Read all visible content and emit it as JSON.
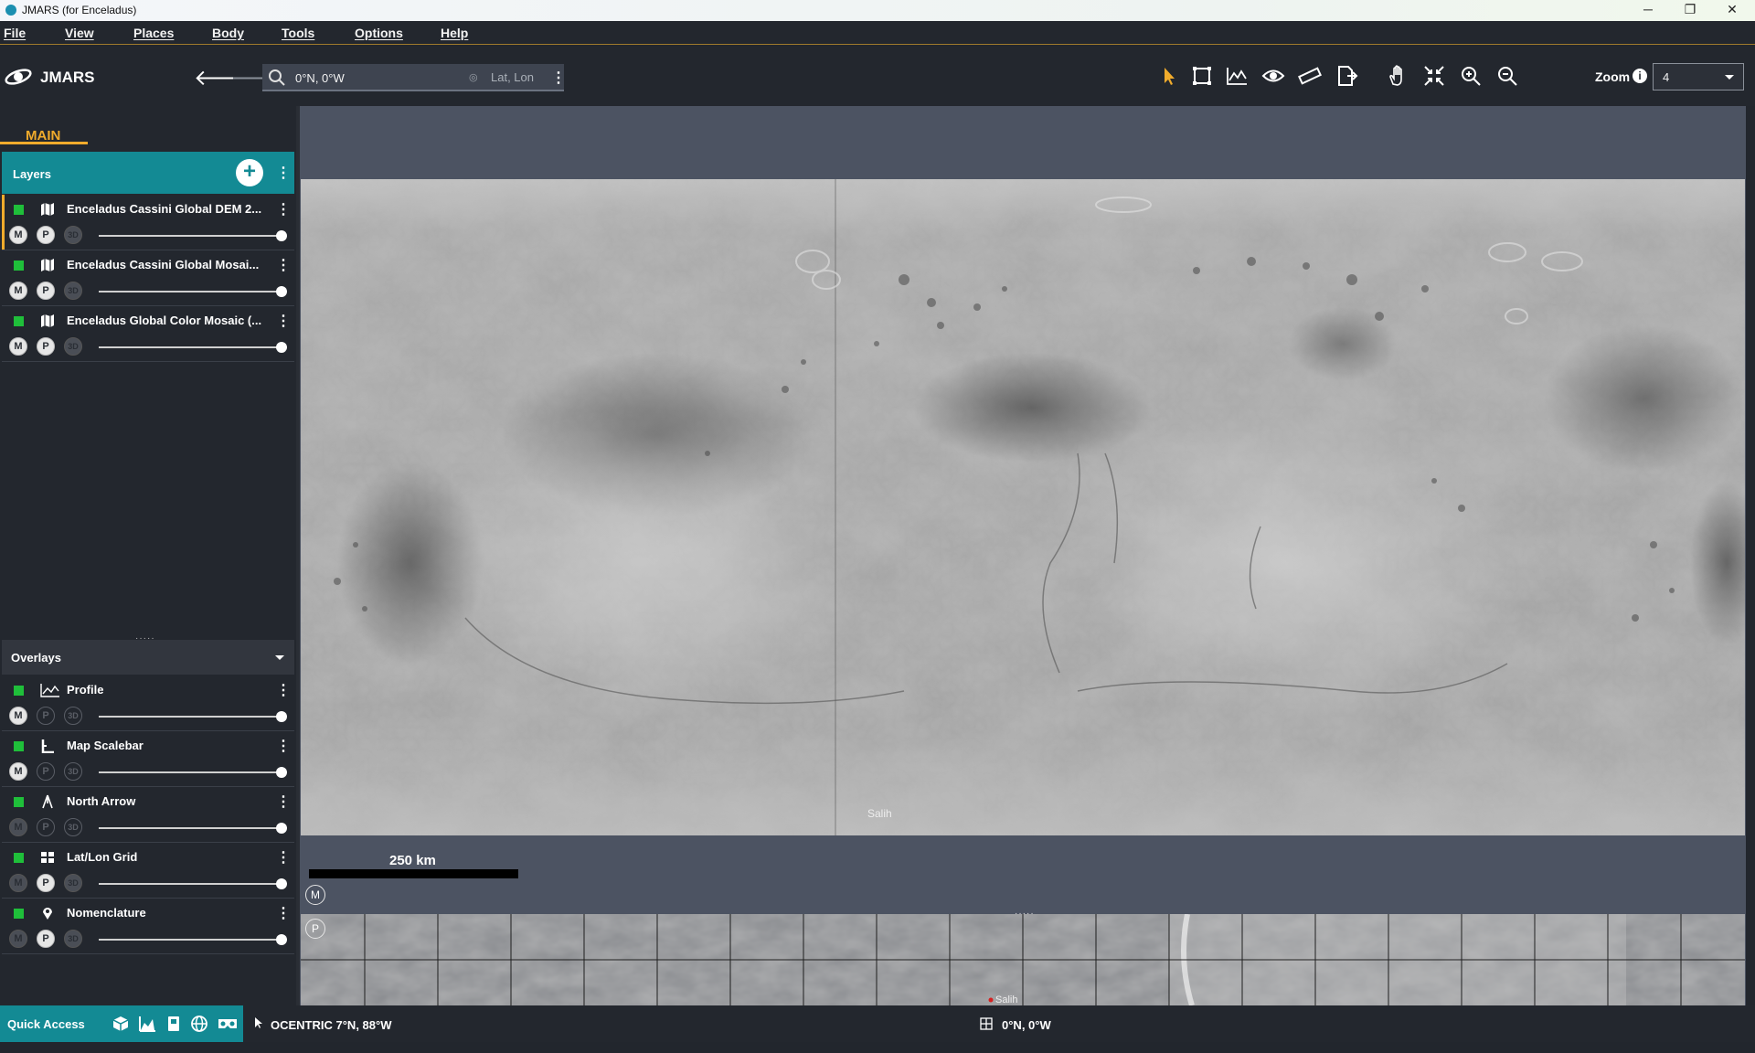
{
  "window": {
    "title": "JMARS (for Enceladus)",
    "min_glyph": "─",
    "max_glyph": "❐",
    "close_glyph": "✕"
  },
  "menu": [
    "File",
    "View",
    "Places",
    "Body",
    "Tools",
    "Options",
    "Help"
  ],
  "toolbar": {
    "logo_text": "JMARS",
    "back_glyph": "🡐",
    "forward_glyph": "🡒",
    "search_value": "0°N, 0°W",
    "search_mode": "Lat, Lon",
    "zoom_label": "Zoom",
    "zoom_value": "4",
    "tools": [
      "select-icon",
      "bounding-box-icon",
      "profile-chart-icon",
      "eye-icon",
      "ruler-icon",
      "export-icon",
      "pan-hand-icon",
      "fit-extent-icon",
      "zoom-in-icon",
      "zoom-out-icon"
    ]
  },
  "sidebar": {
    "tab": "MAIN",
    "layers_title": "Layers",
    "add_glyph": "+",
    "layers": [
      {
        "name": "Enceladus Cassini Global DEM 2...",
        "modes": [
          "M",
          "P",
          "3D"
        ],
        "selected": true
      },
      {
        "name": "Enceladus Cassini Global Mosai...",
        "modes": [
          "M",
          "P",
          "3D"
        ],
        "selected": false
      },
      {
        "name": "Enceladus Global Color Mosaic (...",
        "modes": [
          "M",
          "P",
          "3D"
        ],
        "selected": false
      }
    ],
    "overlays_title": "Overlays",
    "overlays": [
      {
        "name": "Profile",
        "icon": "profile-icon",
        "modes": [
          "M",
          "P",
          "3D"
        ]
      },
      {
        "name": "Map Scalebar",
        "icon": "scalebar-icon",
        "modes": [
          "M",
          "P",
          "3D"
        ]
      },
      {
        "name": "North Arrow",
        "icon": "north-arrow-icon",
        "modes": [
          "M",
          "P",
          "3D"
        ]
      },
      {
        "name": "Lat/Lon Grid",
        "icon": "grid-icon",
        "modes": [
          "M",
          "P",
          "3D"
        ]
      },
      {
        "name": "Nomenclature",
        "icon": "pin-icon",
        "modes": [
          "M",
          "P",
          "3D"
        ]
      }
    ],
    "splitter_glyph": "·····",
    "kebab_glyph": "⋮",
    "quick_access": "Quick Access"
  },
  "map": {
    "scale_label": "250 km",
    "main_badge": "M",
    "panner_badge": "P",
    "feature_label": "Salih"
  },
  "status": {
    "cursor_coord": "OCENTRIC  7°N, 88°W",
    "center_coord": "0°N, 0°W"
  },
  "colors": {
    "accent": "#f0ab2c",
    "teal": "#138a94",
    "check_green": "#1fbf3a"
  }
}
